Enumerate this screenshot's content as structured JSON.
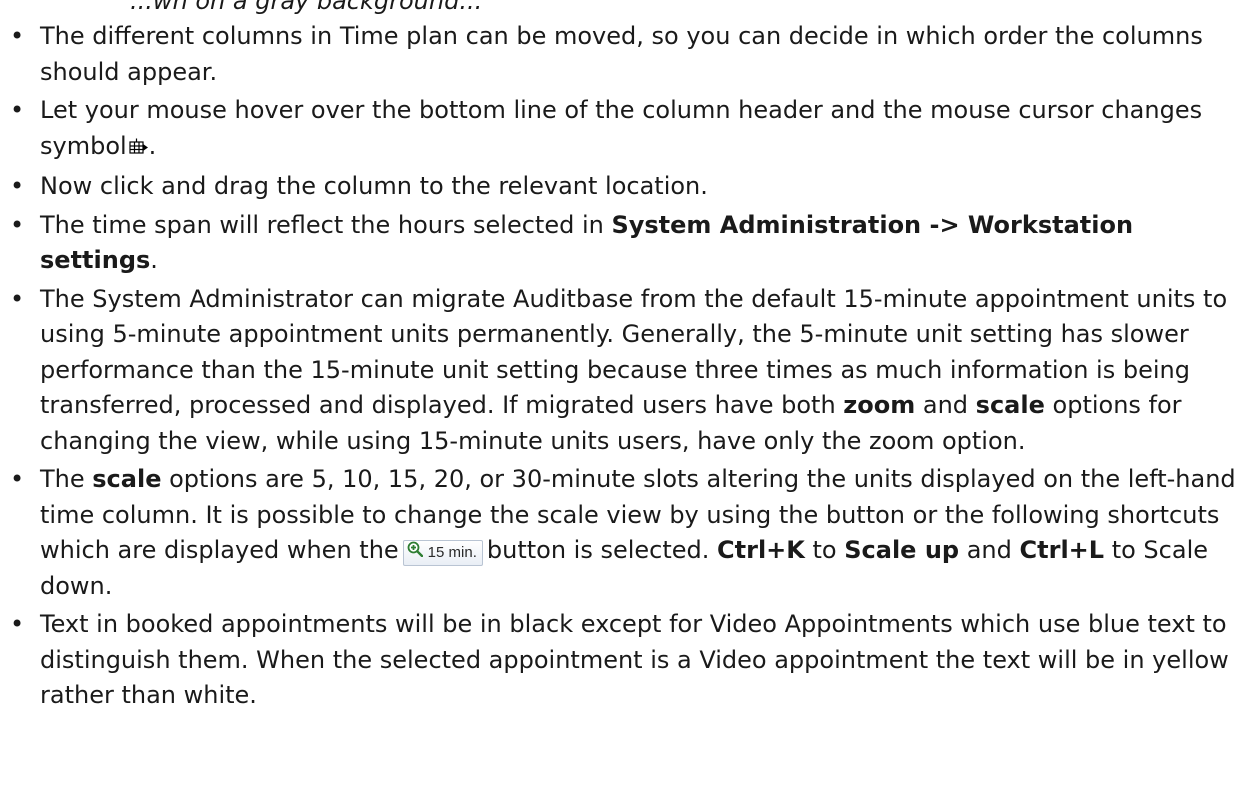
{
  "header_fragment": "...wn on a gray background...",
  "bullets": {
    "b1": "The different columns in Time plan can be moved, so you can decide in which order the columns should appear.",
    "b2_text": "Let your mouse hover over the bottom line of the column header and the mouse cursor changes symbol",
    "b2_end": ".",
    "b3": "Now click and drag the column to the relevant location.",
    "b4_pre": "The time span will reflect the hours selected in ",
    "b4_bold": "System Administration -> Workstation settings",
    "b4_post": ".",
    "b5_pre": "The System Administrator can migrate Auditbase from the default 15-minute appointment units to using 5-minute appointment units permanently. Generally, the 5-minute unit setting has slower performance than the 15-minute unit setting because three times as much information is being transferred, processed and displayed. If migrated users have both ",
    "b5_zoom": "zoom",
    "b5_and": " and ",
    "b5_scale": "scale",
    "b5_post": " options for changing the view, while using 15-minute units users, have only the zoom option.",
    "b6_pre": "The ",
    "b6_scale": "scale",
    "b6_mid": " options are 5, 10, 15, 20, or 30-minute slots altering the units displayed on the left-hand time column. It is possible to change the scale view by using the button or the following shortcuts which are displayed when the",
    "b6_button_label": "15 min.",
    "b6_after_button": "button is selected. ",
    "b6_ctrlk": "Ctrl+K",
    "b6_to": " to ",
    "b6_scaleup": "Scale up",
    "b6_and": " and ",
    "b6_ctrll": "Ctrl+L",
    "b6_post": " to Scale down.",
    "b7": "Text in booked appointments will be in black except for Video Appointments which use blue text to distinguish them. When the selected appointment is a Video appointment the text will be in yellow rather than white."
  },
  "icons": {
    "cursor": "column-move-cursor-icon",
    "zoom": "magnifier-zoom-in-icon"
  },
  "colors": {
    "text": "#1a1a1a",
    "zoom_icon": "#2e7d32"
  }
}
